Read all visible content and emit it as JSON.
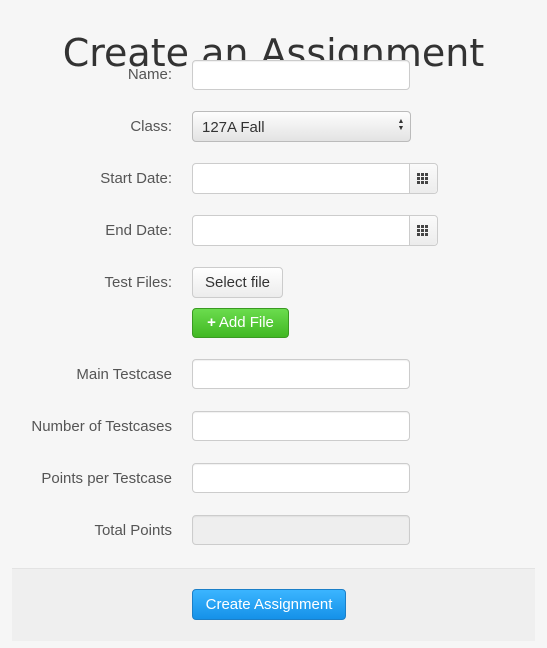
{
  "page": {
    "title": "Create an Assignment"
  },
  "form": {
    "name": {
      "label": "Name:",
      "value": ""
    },
    "class": {
      "label": "Class:",
      "value": "127A Fall"
    },
    "start_date": {
      "label": "Start Date:",
      "value": "",
      "icon": "calendar-icon"
    },
    "end_date": {
      "label": "End Date:",
      "value": "",
      "icon": "calendar-icon"
    },
    "test_files": {
      "label": "Test Files:",
      "select_file_label": "Select file",
      "add_file_label": "Add File"
    },
    "main_testcase": {
      "label": "Main Testcase",
      "value": ""
    },
    "num_testcases": {
      "label": "Number of Testcases",
      "value": ""
    },
    "points_per_testcase": {
      "label": "Points per Testcase",
      "value": ""
    },
    "total_points": {
      "label": "Total Points",
      "value": ""
    }
  },
  "footer": {
    "create_label": "Create Assignment"
  },
  "colors": {
    "add_file_green": "#41b823",
    "create_blue": "#1591e8"
  }
}
